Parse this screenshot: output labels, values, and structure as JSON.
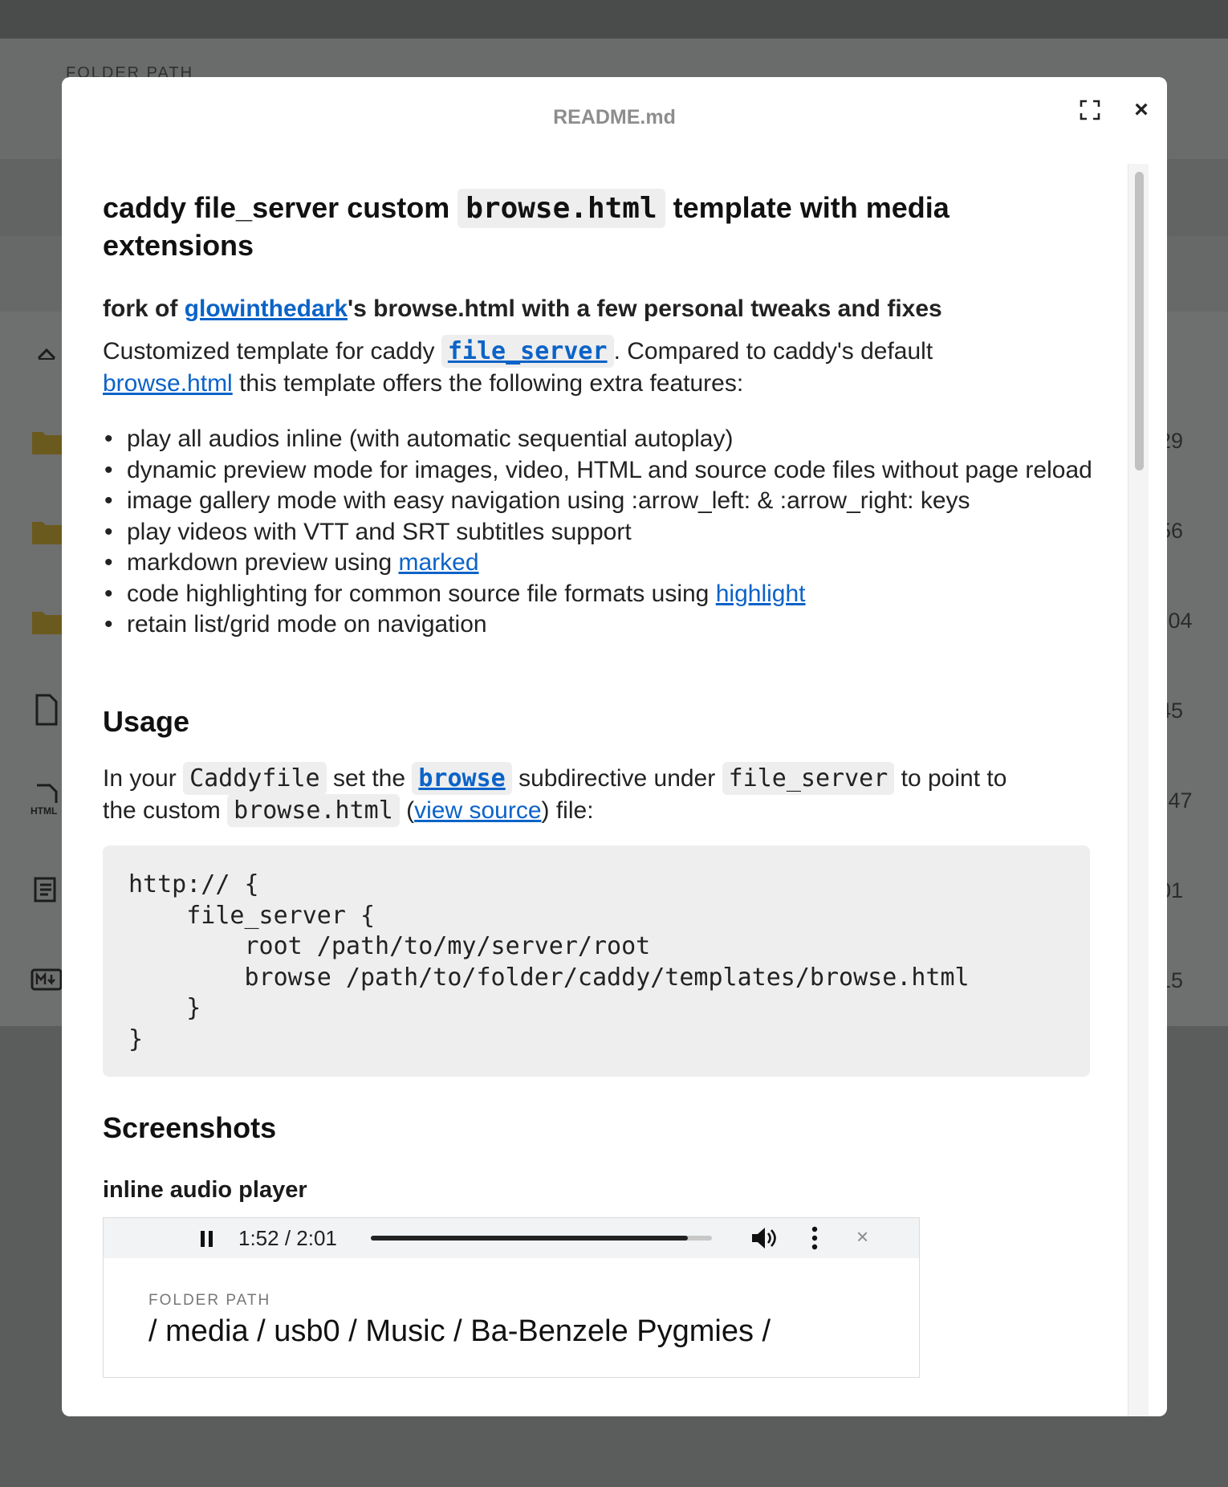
{
  "background": {
    "folder_label": "FOLDER PATH",
    "row_times": [
      "29",
      "56",
      ":04",
      "45",
      ":47",
      "01",
      "15"
    ]
  },
  "modal": {
    "title": "README.md",
    "close_glyph": "×"
  },
  "readme": {
    "h1_part1": "caddy file_server custom",
    "h1_code": "browse.html",
    "h1_part2": "template with media extensions",
    "subtitle_prefix": "fork of",
    "subtitle_link": "glowinthedark",
    "subtitle_suffix": "'s browse.html with a few personal tweaks and fixes",
    "intro_1": "Customized template for caddy",
    "intro_code_link": "file_server",
    "intro_2": ". Compared to caddy's default",
    "intro_link": "browse.html",
    "intro_3": "this template offers the following extra features:",
    "features": [
      {
        "text": "play all audios inline (with automatic sequential autoplay)"
      },
      {
        "text": "dynamic preview mode for images, video, HTML and source code files without page reload"
      },
      {
        "text": "image gallery mode with easy navigation using :arrow_left: & :arrow_right: keys"
      },
      {
        "text": "play videos with VTT and SRT subtitles support"
      },
      {
        "text": "markdown preview using",
        "link": "marked"
      },
      {
        "text": "code highlighting for common source file formats using",
        "link": "highlight"
      },
      {
        "text": "retain list/grid mode on navigation"
      }
    ],
    "usage_heading": "Usage",
    "usage_1": "In your",
    "usage_code1": "Caddyfile",
    "usage_2": "set the",
    "usage_code_link": "browse",
    "usage_3": "subdirective under",
    "usage_code2": "file_server",
    "usage_4": "to point to",
    "usage_5": "the custom",
    "usage_code3": "browse.html",
    "usage_6": "(",
    "usage_link": "view source",
    "usage_7": ") file:",
    "code_block": "http:// {\n    file_server {\n        root /path/to/my/server/root\n        browse /path/to/folder/caddy/templates/browse.html\n    }\n}",
    "screenshots_heading": "Screenshots",
    "shot1_heading": "inline audio player",
    "shot1": {
      "time": "1:52 / 2:01",
      "progress": 0.93,
      "folder_label": "FOLDER PATH",
      "folder_path": "/ media / usb0 / Music / Ba-Benzele Pygmies /",
      "close_glyph": "×"
    }
  }
}
